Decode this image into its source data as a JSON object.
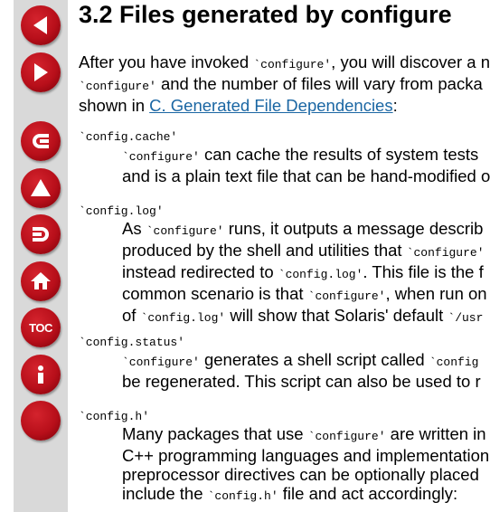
{
  "nav": {
    "buttons": [
      {
        "name": "previous-button",
        "icon": "arrow-left-icon"
      },
      {
        "name": "next-button",
        "icon": "arrow-right-icon"
      },
      {
        "name": "back-button",
        "icon": "return-left-icon"
      },
      {
        "name": "up-button",
        "icon": "arrow-up-icon"
      },
      {
        "name": "forward-button",
        "icon": "return-right-icon"
      },
      {
        "name": "home-button",
        "icon": "home-icon"
      },
      {
        "name": "toc-button",
        "icon": "toc-icon",
        "label": "TOC"
      },
      {
        "name": "info-button",
        "icon": "info-icon"
      },
      {
        "name": "blank-button",
        "icon": "blank-icon"
      }
    ]
  },
  "page": {
    "title": "3.2 Files generated by configure",
    "intro": {
      "line1_a": "After you have invoked ",
      "line1_code": "`configure'",
      "line1_b": ", you will discover a n",
      "line2_code": "`configure'",
      "line2_b": " and the number of files will vary from packa",
      "line3_a": "shown in ",
      "line3_link": "C. Generated File Dependencies",
      "line3_b": ":"
    },
    "entries": [
      {
        "term": "`config.cache'",
        "lines": [
          [
            {
              "c": "`configure'"
            },
            {
              "t": " can cache the results of system tests"
            }
          ],
          [
            {
              "t": "and is a plain text file that can be hand-modified o"
            }
          ]
        ]
      },
      {
        "term": "`config.log'",
        "lines": [
          [
            {
              "t": "As "
            },
            {
              "c": "`configure'"
            },
            {
              "t": " runs, it outputs a message describ"
            }
          ],
          [
            {
              "t": "produced by the shell and utilities that "
            },
            {
              "c": "`configure'"
            }
          ],
          [
            {
              "t": "instead redirected to "
            },
            {
              "c": "`config.log'"
            },
            {
              "t": ". This file is the f"
            }
          ],
          [
            {
              "t": "common scenario is that "
            },
            {
              "c": "`configure'"
            },
            {
              "t": ", when run on"
            }
          ],
          [
            {
              "t": "of "
            },
            {
              "c": "`config.log'"
            },
            {
              "t": " will show that Solaris' default "
            },
            {
              "c": "`/usr"
            }
          ]
        ]
      },
      {
        "term": "`config.status'",
        "lines": [
          [
            {
              "c": "`configure'"
            },
            {
              "t": " generates a shell script called "
            },
            {
              "c": "`config"
            }
          ],
          [
            {
              "t": "be regenerated. This script can also be used to r"
            }
          ]
        ]
      },
      {
        "term": "`config.h'",
        "lines": [
          [
            {
              "t": "Many packages that use "
            },
            {
              "c": "`configure'"
            },
            {
              "t": " are written in"
            }
          ],
          [
            {
              "t": "C++ programming languages and implementation"
            }
          ],
          [
            {
              "t": "preprocessor directives can be optionally placed"
            }
          ],
          [
            {
              "t": "include the "
            },
            {
              "c": "`config.h'"
            },
            {
              "t": " file and act accordingly:"
            }
          ]
        ]
      }
    ]
  }
}
